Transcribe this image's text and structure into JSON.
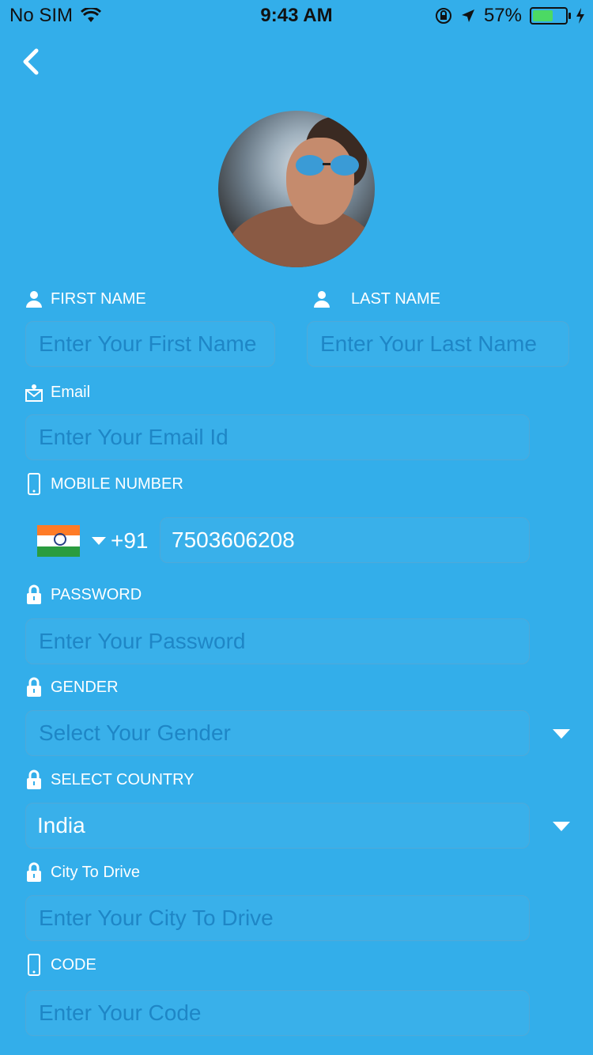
{
  "status": {
    "carrier": "No SIM",
    "time": "9:43 AM",
    "battery": "57%",
    "battery_level": 0.57
  },
  "labels": {
    "first_name": "FIRST NAME",
    "last_name": "LAST NAME",
    "email": "Email",
    "mobile": "MOBILE NUMBER",
    "password": "PASSWORD",
    "gender": "GENDER",
    "country": "SELECT COUNTRY",
    "city": "City To Drive",
    "code": "CODE"
  },
  "placeholders": {
    "first_name": "Enter Your First Name",
    "last_name": "Enter Your Last Name",
    "email": "Enter Your Email Id",
    "password": "Enter Your Password",
    "gender": "Select Your Gender",
    "city": "Enter Your City To Drive",
    "code": "Enter Your Code"
  },
  "values": {
    "dial_code": "+91",
    "mobile_number": "7503606208",
    "country": "India"
  },
  "colors": {
    "background": "#33aeea",
    "placeholder": "#1e86c6",
    "border": "#4fa9d8"
  }
}
